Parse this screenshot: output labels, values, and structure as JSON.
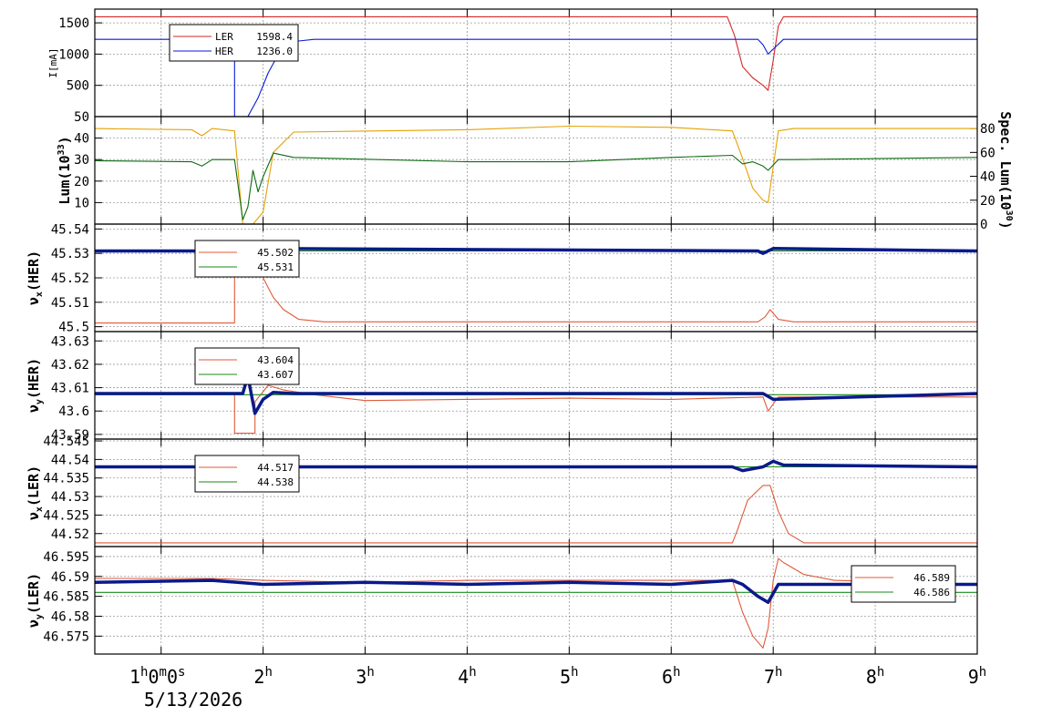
{
  "page": {
    "date_label": "5/13/2026"
  },
  "colors": {
    "ler": "#d62728",
    "her": "#0a1ad8",
    "lum_orange": "#e6a100",
    "lum_green": "#0d6b12",
    "tune_red": "#e05a3a",
    "tune_green": "#1a8a1a",
    "tune_blue": "#0a1a8a",
    "grid": "#9a9a9a"
  },
  "chart_data": {
    "type": "line",
    "x_axis": {
      "range": [
        0.35,
        9.0
      ],
      "ticks": [
        {
          "value": 1,
          "label": "1h0m0s"
        },
        {
          "value": 2,
          "label": "2h"
        },
        {
          "value": 3,
          "label": "3h"
        },
        {
          "value": 4,
          "label": "4h"
        },
        {
          "value": 5,
          "label": "5h"
        },
        {
          "value": 6,
          "label": "6h"
        },
        {
          "value": 7,
          "label": "7h"
        },
        {
          "value": 8,
          "label": "8h"
        },
        {
          "value": 9,
          "label": "9h"
        }
      ],
      "grid": true
    },
    "panels": [
      {
        "id": "current",
        "ylabel": "I[mA]",
        "ylim": [
          0,
          1720
        ],
        "yticks": [
          500,
          1000,
          1500
        ],
        "grid": true,
        "legend": [
          {
            "label": "LER",
            "value": "1598.4",
            "color": "#d62728"
          },
          {
            "label": "HER",
            "value": "1236.0",
            "color": "#0a1ad8"
          }
        ],
        "series": [
          {
            "name": "LER",
            "color": "#d62728",
            "x": [
              0.35,
              6.55,
              6.62,
              6.7,
              6.8,
              6.9,
              6.95,
              7.0,
              7.05,
              7.1,
              9.0
            ],
            "y": [
              1598,
              1598,
              1300,
              800,
              620,
              500,
              420,
              900,
              1450,
              1598,
              1598
            ]
          },
          {
            "name": "HER",
            "color": "#0a1ad8",
            "x": [
              0.35,
              1.72,
              1.72,
              1.85,
              1.95,
              2.05,
              2.15,
              2.25,
              2.35,
              2.5,
              6.85,
              6.9,
              6.95,
              7.0,
              7.1,
              9.0
            ],
            "y": [
              1236,
              1236,
              0,
              0,
              300,
              700,
              1000,
              1150,
              1210,
              1236,
              1236,
              1150,
              1000,
              1080,
              1236,
              1236
            ]
          }
        ]
      },
      {
        "id": "luminosity",
        "ylabel": "Lum(10^33)",
        "ylim": [
          0,
          50
        ],
        "yticks": [
          10,
          20,
          30,
          40,
          50
        ],
        "y2label": "Spec. Lum(10^30)",
        "y2lim": [
          0,
          90
        ],
        "y2ticks": [
          0,
          20,
          40,
          60,
          80
        ],
        "grid": true,
        "series": [
          {
            "name": "",
            "color": "#e6a100",
            "axis": "right",
            "x": [
              0.35,
              1.3,
              1.4,
              1.5,
              1.72,
              1.8,
              1.9,
              2.0,
              2.1,
              2.3,
              4.0,
              5.0,
              6.0,
              6.6,
              6.7,
              6.8,
              6.9,
              6.95,
              7.05,
              7.2,
              9.0
            ],
            "y": [
              80,
              79,
              74,
              80,
              78,
              0,
              0,
              10,
              60,
              77,
              79,
              82,
              81,
              78,
              55,
              30,
              20,
              18,
              78,
              80,
              80
            ]
          },
          {
            "name": "",
            "color": "#0d6b12",
            "axis": "left",
            "x": [
              0.35,
              1.3,
              1.4,
              1.5,
              1.72,
              1.8,
              1.85,
              1.9,
              1.95,
              2.0,
              2.1,
              2.3,
              4.0,
              5.0,
              6.0,
              6.6,
              6.7,
              6.8,
              6.9,
              6.95,
              7.05,
              7.2,
              9.0
            ],
            "y": [
              29.5,
              29,
              27,
              30,
              30,
              2,
              8,
              25,
              15,
              22,
              33,
              31,
              29,
              29,
              31,
              32,
              28,
              29,
              27,
              25,
              30,
              30,
              31
            ]
          }
        ]
      },
      {
        "id": "nux_her",
        "ylabel": "νx(HER)",
        "ylim": [
          45.498,
          45.542
        ],
        "yticks": [
          45.5,
          45.51,
          45.52,
          45.53,
          45.54
        ],
        "grid": true,
        "legend": [
          {
            "label": "",
            "value": "45.502",
            "color": "#e05a3a"
          },
          {
            "label": "",
            "value": "45.531",
            "color": "#1a8a1a"
          }
        ],
        "series": [
          {
            "name": "",
            "color": "#e05a3a",
            "x": [
              0.35,
              1.72,
              1.72,
              1.85,
              1.9,
              2.0,
              2.1,
              2.2,
              2.35,
              2.6,
              6.85,
              6.92,
              6.97,
              7.05,
              7.2,
              9.0
            ],
            "y": [
              45.5015,
              45.5015,
              45.531,
              45.531,
              45.528,
              45.52,
              45.512,
              45.507,
              45.503,
              45.502,
              45.502,
              45.504,
              45.507,
              45.503,
              45.502,
              45.502
            ]
          },
          {
            "name": "",
            "color": "#1a8a1a",
            "x": [
              0.35,
              9.0
            ],
            "y": [
              45.531,
              45.531
            ]
          },
          {
            "name": "",
            "color": "#0a1a8a",
            "thick": true,
            "x": [
              0.35,
              1.8,
              1.85,
              1.9,
              2.0,
              6.85,
              6.9,
              7.0,
              9.0
            ],
            "y": [
              45.531,
              45.531,
              45.532,
              45.529,
              45.532,
              45.531,
              45.53,
              45.532,
              45.531
            ]
          }
        ]
      },
      {
        "id": "nuy_her",
        "ylabel": "νy(HER)",
        "ylim": [
          43.588,
          43.634
        ],
        "yticks": [
          43.59,
          43.6,
          43.61,
          43.62,
          43.63
        ],
        "grid": true,
        "legend": [
          {
            "label": "",
            "value": "43.604",
            "color": "#e05a3a"
          },
          {
            "label": "",
            "value": "43.607",
            "color": "#1a8a1a"
          }
        ],
        "series": [
          {
            "name": "",
            "color": "#e05a3a",
            "x": [
              0.35,
              1.72,
              1.72,
              1.92,
              1.92,
              2.05,
              2.2,
              2.5,
              3.0,
              4.0,
              5.0,
              6.0,
              6.9,
              6.95,
              7.05,
              7.3,
              9.0
            ],
            "y": [
              43.6075,
              43.6075,
              43.5905,
              43.5905,
              43.604,
              43.611,
              43.609,
              43.607,
              43.6045,
              43.605,
              43.6055,
              43.605,
              43.606,
              43.6,
              43.606,
              43.606,
              43.606
            ]
          },
          {
            "name": "",
            "color": "#1a8a1a",
            "x": [
              0.35,
              9.0
            ],
            "y": [
              43.607,
              43.607
            ]
          },
          {
            "name": "",
            "color": "#0a1a8a",
            "thick": true,
            "x": [
              0.35,
              1.8,
              1.85,
              1.92,
              2.0,
              2.1,
              2.3,
              6.9,
              7.0,
              9.0
            ],
            "y": [
              43.6075,
              43.6075,
              43.615,
              43.599,
              43.605,
              43.608,
              43.6075,
              43.6075,
              43.605,
              43.6075
            ]
          }
        ]
      },
      {
        "id": "nux_ler",
        "ylabel": "νx(LER)",
        "ylim": [
          44.5165,
          44.5455
        ],
        "yticks": [
          44.52,
          44.525,
          44.53,
          44.535,
          44.54,
          44.545
        ],
        "grid": true,
        "legend": [
          {
            "label": "",
            "value": "44.517",
            "color": "#e05a3a"
          },
          {
            "label": "",
            "value": "44.538",
            "color": "#1a8a1a"
          }
        ],
        "series": [
          {
            "name": "",
            "color": "#e05a3a",
            "x": [
              0.35,
              6.6,
              6.65,
              6.75,
              6.9,
              6.97,
              7.05,
              7.15,
              7.3,
              9.0
            ],
            "y": [
              44.5175,
              44.5175,
              44.521,
              44.529,
              44.533,
              44.533,
              44.526,
              44.52,
              44.5175,
              44.5175
            ]
          },
          {
            "name": "",
            "color": "#1a8a1a",
            "x": [
              0.35,
              9.0
            ],
            "y": [
              44.538,
              44.538
            ]
          },
          {
            "name": "",
            "color": "#0a1a8a",
            "thick": true,
            "x": [
              0.35,
              6.6,
              6.7,
              6.9,
              7.0,
              7.1,
              9.0
            ],
            "y": [
              44.538,
              44.538,
              44.537,
              44.538,
              44.5395,
              44.5385,
              44.538
            ]
          }
        ]
      },
      {
        "id": "nuy_ler",
        "ylabel": "νy(LER)",
        "ylim": [
          44.0,
          44.0
        ],
        "yticks": [
          46.575,
          46.58,
          46.585,
          46.59,
          46.595
        ],
        "ylim_actual": [
          46.5705,
          46.5975
        ],
        "grid": true,
        "legend": [
          {
            "label": "",
            "value": "46.589",
            "color": "#e05a3a"
          },
          {
            "label": "",
            "value": "46.586",
            "color": "#1a8a1a"
          }
        ],
        "series": [
          {
            "name": "",
            "color": "#e05a3a",
            "x": [
              0.35,
              1.5,
              2.0,
              3.0,
              4.0,
              5.0,
              6.0,
              6.6,
              6.7,
              6.8,
              6.9,
              6.95,
              7.0,
              7.05,
              7.1,
              7.3,
              7.6,
              9.0
            ],
            "y": [
              46.5895,
              46.5895,
              46.589,
              46.5885,
              46.589,
              46.589,
              46.589,
              46.589,
              46.581,
              46.575,
              46.572,
              46.577,
              46.589,
              46.5945,
              46.5935,
              46.5905,
              46.589,
              46.588
            ]
          },
          {
            "name": "",
            "color": "#1a8a1a",
            "x": [
              0.35,
              9.0
            ],
            "y": [
              46.586,
              46.586
            ]
          },
          {
            "name": "",
            "color": "#0a1a8a",
            "thick": true,
            "x": [
              0.35,
              1.5,
              2.0,
              3.0,
              4.0,
              5.0,
              6.0,
              6.6,
              6.7,
              6.85,
              6.95,
              7.05,
              7.2,
              9.0
            ],
            "y": [
              46.5885,
              46.589,
              46.588,
              46.5885,
              46.588,
              46.5885,
              46.588,
              46.589,
              46.588,
              46.585,
              46.5835,
              46.588,
              46.588,
              46.588
            ]
          }
        ]
      }
    ]
  }
}
